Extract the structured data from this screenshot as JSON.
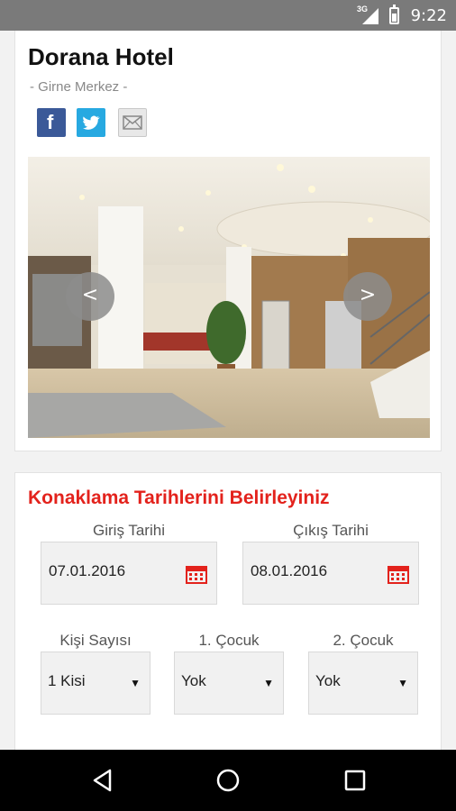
{
  "status_bar": {
    "network": "3G",
    "time": "9:22"
  },
  "hotel": {
    "name": "Dorana Hotel",
    "location": "- Girne Merkez -"
  },
  "share": {
    "facebook_glyph": "f",
    "icons": [
      "facebook-icon",
      "twitter-icon",
      "mail-icon"
    ]
  },
  "gallery": {
    "prev_label": "<",
    "next_label": ">"
  },
  "booking": {
    "title": "Konaklama Tarihlerini Belirleyiniz",
    "checkin_label": "Giriş Tarihi",
    "checkin_value": "07.01.2016",
    "checkout_label": "Çıkış Tarihi",
    "checkout_value": "08.01.2016",
    "guests_label": "Kişi Sayısı",
    "guests_value": "1 Kisi",
    "child1_label": "1. Çocuk",
    "child1_value": "Yok",
    "child2_label": "2. Çocuk",
    "child2_value": "Yok",
    "dropdown_glyph": "▼"
  },
  "colors": {
    "accent": "#e3221c",
    "facebook": "#3b5998",
    "twitter": "#27a9e1",
    "status_bar": "#7a7a7a"
  }
}
